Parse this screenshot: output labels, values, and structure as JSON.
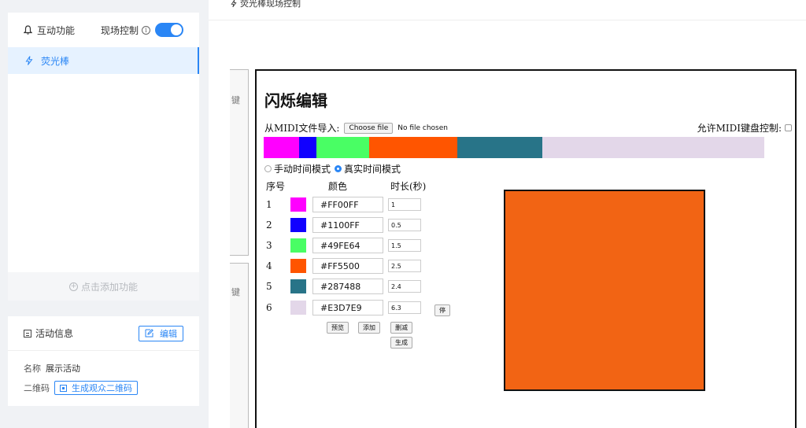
{
  "sidebar": {
    "interactive_title": "互动功能",
    "live_control_label": "现场控制",
    "live_control_on": true,
    "function_item": "荧光棒",
    "add_function": "点击添加功能",
    "activity_title": "活动信息",
    "edit_label": "编辑",
    "name_label": "名称",
    "name_value": "展示活动",
    "qr_label": "二维码",
    "qr_button": "生成观众二维码"
  },
  "main": {
    "breadcrumb": "荧光棒现场控制",
    "ghost_key1": "键",
    "ghost_key2": "键",
    "editor": {
      "title": "闪烁编辑",
      "import_label": "从MIDI文件导入:",
      "file_button": "Choose file",
      "file_status": "No file chosen",
      "midi_control": "允许MIDI键盘控制:",
      "mode_manual": "手动时间模式",
      "mode_realtime": "真实时间模式",
      "selected_mode": "realtime",
      "col_index": "序号",
      "col_color": "颜色",
      "col_duration": "时长(秒)",
      "rows": [
        {
          "index": "1",
          "color": "#FF00FF",
          "duration": "1"
        },
        {
          "index": "2",
          "color": "#1100FF",
          "duration": "0.5"
        },
        {
          "index": "3",
          "color": "#49FE64",
          "duration": "1.5"
        },
        {
          "index": "4",
          "color": "#FF5500",
          "duration": "2.5"
        },
        {
          "index": "5",
          "color": "#287488",
          "duration": "2.4"
        },
        {
          "index": "6",
          "color": "#E3D7E9",
          "duration": "6.3"
        }
      ],
      "stop_button": "停",
      "preview_button": "预览",
      "add_button": "添加",
      "delete_button": "删减",
      "generate_button": "生成",
      "preview_color": "#F26414"
    }
  }
}
